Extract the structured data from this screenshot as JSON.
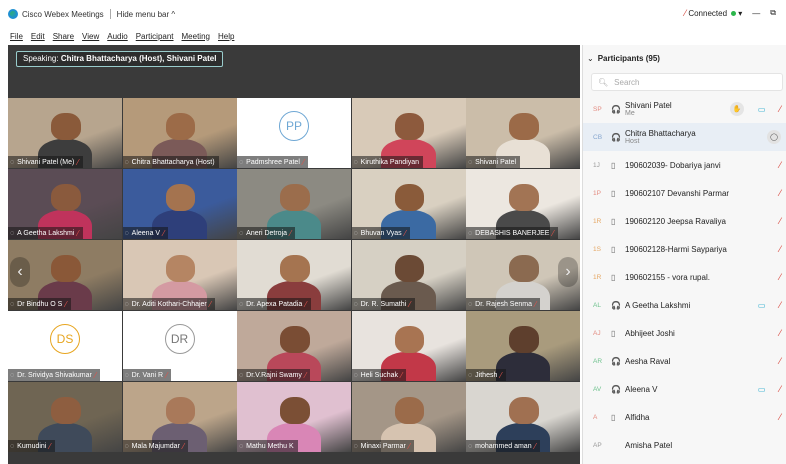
{
  "titlebar": {
    "app_name": "Cisco Webex Meetings",
    "hide_menu": "Hide menu bar ^",
    "connected": "Connected",
    "min": "—",
    "max": "⧉"
  },
  "menu": [
    "File",
    "Edit",
    "Share",
    "View",
    "Audio",
    "Participant",
    "Meeting",
    "Help"
  ],
  "speaking": {
    "label": "Speaking:",
    "names": "Chitra Bhattacharya (Host), Shivani Patel"
  },
  "tiles": [
    {
      "name": "Shivani Patel (Me)",
      "type": "video",
      "bg": "#b7a58e",
      "skin": "#8a5a3a",
      "shirt": "#3d3d3d",
      "mic": true
    },
    {
      "name": "Chitra Bhattacharya (Host)",
      "type": "video",
      "bg": "#b59a7a",
      "skin": "#9c6b48",
      "shirt": "#7b5a58",
      "active": true,
      "mic": false
    },
    {
      "name": "Padmshree Patel",
      "type": "avatar",
      "initials": "PP",
      "mic": true
    },
    {
      "name": "Kiruthika Pandiyan",
      "type": "video",
      "bg": "#d8cab8",
      "skin": "#8d5a3d",
      "shirt": "#d0455a",
      "mic": false
    },
    {
      "name": "Shivani Patel",
      "type": "video",
      "bg": "#cbbda9",
      "skin": "#9b6a48",
      "shirt": "#e8e0d5",
      "active": true,
      "mic": false
    },
    {
      "name": "A Geetha Lakshmi",
      "type": "video",
      "bg": "#5b4c55",
      "skin": "#8a5a3d",
      "shirt": "#c0335c",
      "mic": true
    },
    {
      "name": "Aleena V",
      "type": "video",
      "bg": "#3b5b9c",
      "skin": "#a4734f",
      "shirt": "#2e3f7a",
      "mic": true
    },
    {
      "name": "Aneri Detroja",
      "type": "video",
      "bg": "#8c8a82",
      "skin": "#9b6d4c",
      "shirt": "#4b8a8a",
      "mic": true
    },
    {
      "name": "Bhuvan Vyas",
      "type": "video",
      "bg": "#d9d0c1",
      "skin": "#8a5b3a",
      "shirt": "#3b6aa3",
      "mic": true
    },
    {
      "name": "DEBASHIS BANERJEE",
      "type": "video",
      "bg": "#ece7e0",
      "skin": "#a27454",
      "shirt": "#4a4a4a",
      "mic": true
    },
    {
      "name": "Dr Bindhu O S",
      "type": "video",
      "bg": "#8e7c63",
      "skin": "#8a5838",
      "shirt": "#6a3b4a",
      "mic": true
    },
    {
      "name": "Dr. Aditi Kothari-Chhajer",
      "type": "video",
      "bg": "#d9c7b5",
      "skin": "#b58563",
      "shirt": "#d49aa2",
      "mic": true
    },
    {
      "name": "Dr. Apexa Patadia",
      "type": "video",
      "bg": "#e1dcd3",
      "skin": "#a57450",
      "shirt": "#8a3d3d",
      "mic": true
    },
    {
      "name": "Dr. R. Sumathi",
      "type": "video",
      "bg": "#d6d0c4",
      "skin": "#6b4a35",
      "shirt": "#6a5a4e",
      "mic": true
    },
    {
      "name": "Dr. Rajesh Senma",
      "type": "video",
      "bg": "#cfc6b7",
      "skin": "#8b6a50",
      "shirt": "#d4d2ce",
      "mic": true
    },
    {
      "name": "Dr. Srividya Shivakumar",
      "type": "avatar",
      "initials": "DS",
      "style": "ds",
      "warn": true,
      "mic": true
    },
    {
      "name": "Dr. Vani R",
      "type": "avatar",
      "initials": "DR",
      "style": "dr",
      "mic": true
    },
    {
      "name": "Dr.V.Rajni Swamy",
      "type": "video",
      "bg": "#bfa99a",
      "skin": "#7a4d34",
      "shirt": "#b9485a",
      "mic": true
    },
    {
      "name": "Heli Suchak",
      "type": "video",
      "bg": "#e8e3de",
      "skin": "#a87452",
      "shirt": "#c23848",
      "mic": true
    },
    {
      "name": "Jithesh",
      "type": "video",
      "bg": "#a99b7d",
      "skin": "#5e3f2d",
      "shirt": "#2d2d3a",
      "mic": true
    },
    {
      "name": "Kumudini",
      "type": "video",
      "bg": "#6f6553",
      "skin": "#8e5e40",
      "shirt": "#3f4a5a",
      "mic": true
    },
    {
      "name": "Mala Majumdar",
      "type": "video",
      "bg": "#bca58a",
      "skin": "#a9795a",
      "shirt": "#6c5f72",
      "mic": true
    },
    {
      "name": "Mathu Methu K",
      "type": "video",
      "bg": "#e0c0d0",
      "skin": "#7b4f35",
      "shirt": "#d986b6",
      "mic": false
    },
    {
      "name": "Minaxi Parmar",
      "type": "video",
      "bg": "#a49687",
      "skin": "#9b6b4a",
      "shirt": "#d6c3b0",
      "mic": true
    },
    {
      "name": "mohammed aman",
      "type": "video",
      "bg": "#d9d6d0",
      "skin": "#a07051",
      "shirt": "#2d3f5a",
      "mic": true
    }
  ],
  "panel": {
    "title": "Participants (95)",
    "search_placeholder": "Search",
    "participants": [
      {
        "initials": "SP",
        "name": "Shivani Patel",
        "sub": "Me",
        "device": "🎧",
        "hand": true,
        "cam": true,
        "mic": true
      },
      {
        "initials": "CB",
        "name": "Chitra Bhattacharya",
        "sub": "Host",
        "device": "🎧",
        "chat": true,
        "selected": true
      },
      {
        "initials": "1J",
        "name": "190602039- Dobariya janvi",
        "device": "▯",
        "mic": true
      },
      {
        "initials": "1P",
        "name": "190602107 Devanshi Parmar",
        "device": "▯",
        "mic": true
      },
      {
        "initials": "1R",
        "name": "190602120 Jeepsa Ravaliya",
        "device": "▯",
        "mic": true
      },
      {
        "initials": "1S",
        "name": "190602128-Harmi Saypariya",
        "device": "▯",
        "mic": true
      },
      {
        "initials": "1R",
        "name": "190602155 - vora rupal.",
        "device": "▯",
        "mic": true
      },
      {
        "initials": "AL",
        "name": "A Geetha Lakshmi",
        "device": "🎧",
        "cam": true,
        "mic": true
      },
      {
        "initials": "AJ",
        "name": "Abhijeet Joshi",
        "device": "▯",
        "mic": true
      },
      {
        "initials": "AR",
        "name": "Aesha Raval",
        "device": "🎧",
        "mic": true
      },
      {
        "initials": "AV",
        "name": "Aleena V",
        "device": "🎧",
        "cam": true,
        "mic": true
      },
      {
        "initials": "A",
        "name": "Alfidha",
        "device": "▯",
        "mic": true
      },
      {
        "initials": "AP",
        "name": "Amisha Patel",
        "device": ""
      }
    ]
  }
}
